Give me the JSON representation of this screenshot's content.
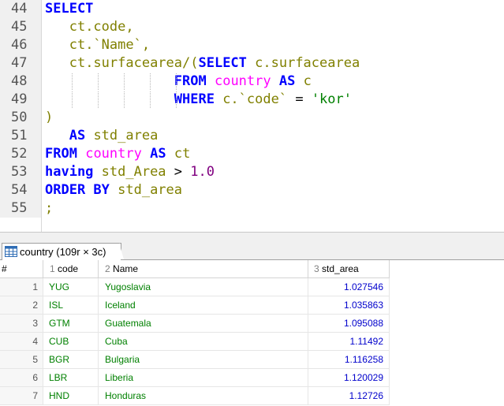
{
  "editor": {
    "lines": [
      {
        "n": "44",
        "tokens": [
          {
            "t": "SELECT",
            "c": "kw"
          }
        ]
      },
      {
        "n": "45",
        "tokens": [
          {
            "t": "   ",
            "c": "op"
          },
          {
            "t": "ct.code,",
            "c": "id"
          }
        ]
      },
      {
        "n": "46",
        "tokens": [
          {
            "t": "   ",
            "c": "op"
          },
          {
            "t": "ct.`Name`,",
            "c": "id"
          }
        ]
      },
      {
        "n": "47",
        "tokens": [
          {
            "t": "   ",
            "c": "op"
          },
          {
            "t": "ct.surfacearea/(",
            "c": "id"
          },
          {
            "t": "SELECT",
            "c": "kw"
          },
          {
            "t": " c.surfacearea",
            "c": "id"
          }
        ]
      },
      {
        "n": "48",
        "tokens": [
          {
            "t": "                ",
            "c": "op"
          },
          {
            "t": "FROM",
            "c": "kw"
          },
          {
            "t": " ",
            "c": "op"
          },
          {
            "t": "country",
            "c": "tbl"
          },
          {
            "t": " ",
            "c": "op"
          },
          {
            "t": "AS",
            "c": "kw"
          },
          {
            "t": " c",
            "c": "id"
          }
        ]
      },
      {
        "n": "49",
        "tokens": [
          {
            "t": "                ",
            "c": "op"
          },
          {
            "t": "WHERE",
            "c": "kw"
          },
          {
            "t": " c.`code` ",
            "c": "id"
          },
          {
            "t": "=",
            "c": "op"
          },
          {
            "t": " ",
            "c": "op"
          },
          {
            "t": "'kor'",
            "c": "str"
          }
        ]
      },
      {
        "n": "50",
        "tokens": [
          {
            "t": ")",
            "c": "id"
          }
        ]
      },
      {
        "n": "51",
        "tokens": [
          {
            "t": "   ",
            "c": "op"
          },
          {
            "t": "AS",
            "c": "kw"
          },
          {
            "t": " std_area",
            "c": "id"
          }
        ]
      },
      {
        "n": "52",
        "tokens": [
          {
            "t": "FROM",
            "c": "kw"
          },
          {
            "t": " ",
            "c": "op"
          },
          {
            "t": "country",
            "c": "tbl"
          },
          {
            "t": " ",
            "c": "op"
          },
          {
            "t": "AS",
            "c": "kw"
          },
          {
            "t": " ct",
            "c": "id"
          }
        ]
      },
      {
        "n": "53",
        "tokens": [
          {
            "t": "having",
            "c": "kw"
          },
          {
            "t": " std_Area ",
            "c": "id"
          },
          {
            "t": ">",
            "c": "op"
          },
          {
            "t": " ",
            "c": "op"
          },
          {
            "t": "1.0",
            "c": "num"
          }
        ]
      },
      {
        "n": "54",
        "tokens": [
          {
            "t": "ORDER BY",
            "c": "kw"
          },
          {
            "t": " std_area",
            "c": "id"
          }
        ]
      },
      {
        "n": "55",
        "tokens": [
          {
            "t": ";",
            "c": "id"
          }
        ]
      }
    ]
  },
  "result_tab": {
    "label": "country (109r × 3c)",
    "icon": "table-grid-icon"
  },
  "grid": {
    "index_header": "#",
    "columns": [
      {
        "num": "1",
        "name": "code"
      },
      {
        "num": "2",
        "name": "Name"
      },
      {
        "num": "3",
        "name": "std_area"
      }
    ],
    "rows": [
      {
        "idx": "1",
        "code": "YUG",
        "name": "Yugoslavia",
        "std_area": "1.027546"
      },
      {
        "idx": "2",
        "code": "ISL",
        "name": "Iceland",
        "std_area": "1.035863"
      },
      {
        "idx": "3",
        "code": "GTM",
        "name": "Guatemala",
        "std_area": "1.095088"
      },
      {
        "idx": "4",
        "code": "CUB",
        "name": "Cuba",
        "std_area": "1.11492"
      },
      {
        "idx": "5",
        "code": "BGR",
        "name": "Bulgaria",
        "std_area": "1.116258"
      },
      {
        "idx": "6",
        "code": "LBR",
        "name": "Liberia",
        "std_area": "1.120029"
      },
      {
        "idx": "7",
        "code": "HND",
        "name": "Honduras",
        "std_area": "1.12726"
      }
    ]
  },
  "colors": {
    "keyword": "#0000ff",
    "identifier": "#808000",
    "table": "#ff00ff",
    "string": "#008000",
    "number": "#800080",
    "cell_text": "#008000",
    "cell_numeric": "#0000cc"
  }
}
